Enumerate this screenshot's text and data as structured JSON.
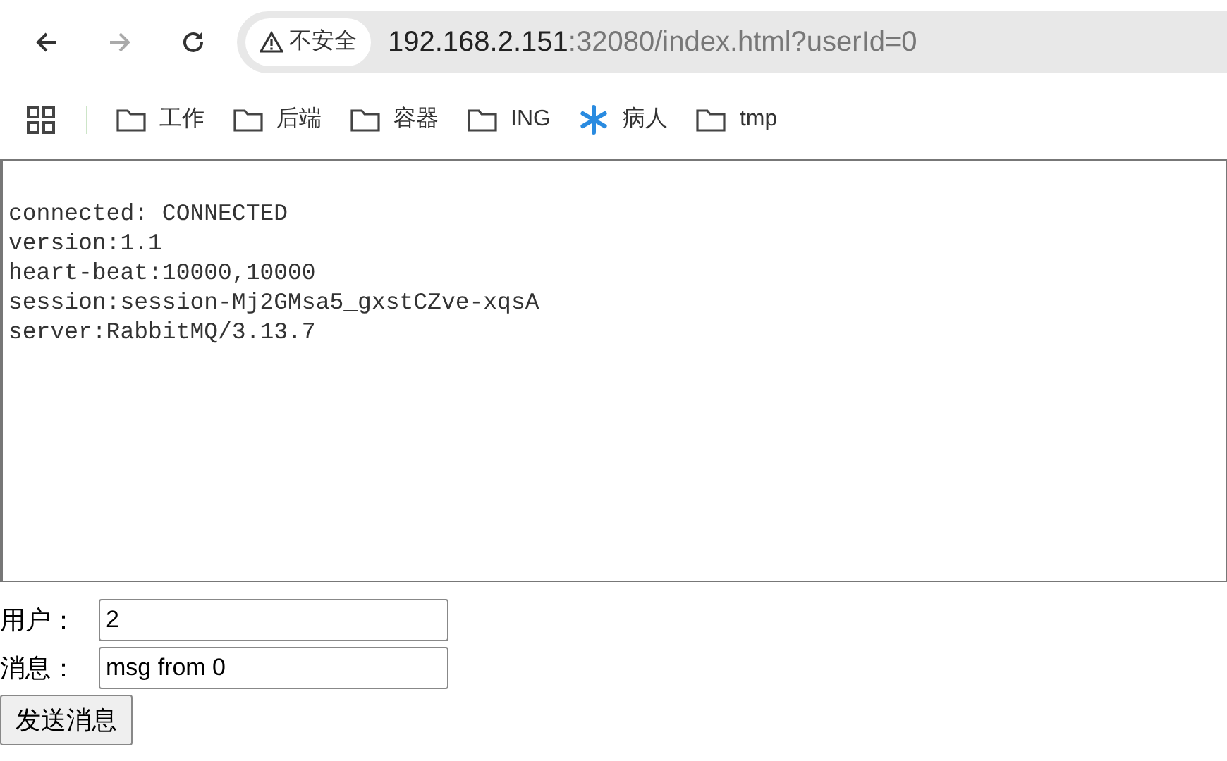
{
  "toolbar": {
    "security_label": "不安全",
    "url_host": "192.168.2.151",
    "url_rest": ":32080/index.html?userId=0"
  },
  "bookmarks": [
    {
      "kind": "folder",
      "label": "工作"
    },
    {
      "kind": "folder",
      "label": "后端"
    },
    {
      "kind": "folder",
      "label": "容器"
    },
    {
      "kind": "folder",
      "label": "ING"
    },
    {
      "kind": "site",
      "label": "病人"
    },
    {
      "kind": "folder",
      "label": "tmp"
    }
  ],
  "log_lines": [
    "connected: CONNECTED",
    "version:1.1",
    "heart-beat:10000,10000",
    "session:session-Mj2GMsa5_gxstCZve-xqsA",
    "server:RabbitMQ/3.13.7"
  ],
  "form": {
    "fields": [
      {
        "label": "用户：",
        "value": "2"
      },
      {
        "label": "消息：",
        "value": "msg from 0"
      }
    ],
    "submit": "发送消息"
  }
}
